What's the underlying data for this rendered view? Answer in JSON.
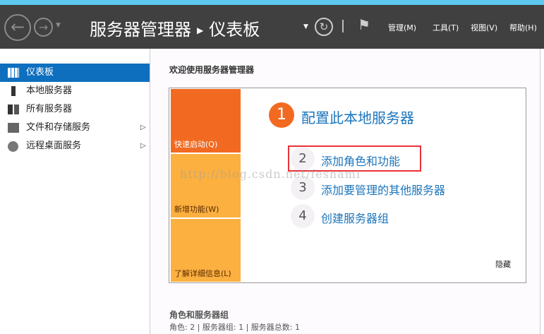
{
  "header": {
    "app": "服务器管理器",
    "page": "仪表板",
    "menus": [
      "管理(M)",
      "工具(T)",
      "视图(V)",
      "帮助(H)"
    ]
  },
  "sidebar": {
    "items": [
      {
        "label": "仪表板"
      },
      {
        "label": "本地服务器"
      },
      {
        "label": "所有服务器"
      },
      {
        "label": "文件和存储服务"
      },
      {
        "label": "远程桌面服务"
      }
    ]
  },
  "main": {
    "welcome": "欢迎使用服务器管理器",
    "tiles": [
      "快速启动(Q)",
      "新增功能(W)",
      "了解详细信息(L)"
    ],
    "step1": {
      "num": "1",
      "label": "配置此本地服务器"
    },
    "steps": [
      {
        "num": "2",
        "label": "添加角色和功能"
      },
      {
        "num": "3",
        "label": "添加要管理的其他服务器"
      },
      {
        "num": "4",
        "label": "创建服务器组"
      }
    ],
    "hide": "隐藏",
    "watermark": "http://blog.csdn.net/feshami",
    "roles_title": "角色和服务器组",
    "roles_summary": "角色: 2 | 服务器组: 1 | 服务器总数: 1"
  },
  "colors": {
    "accent": "#0e6fbf",
    "orange": "#f26a21",
    "yellow": "#fbb040",
    "highlight": "#e8333a"
  }
}
